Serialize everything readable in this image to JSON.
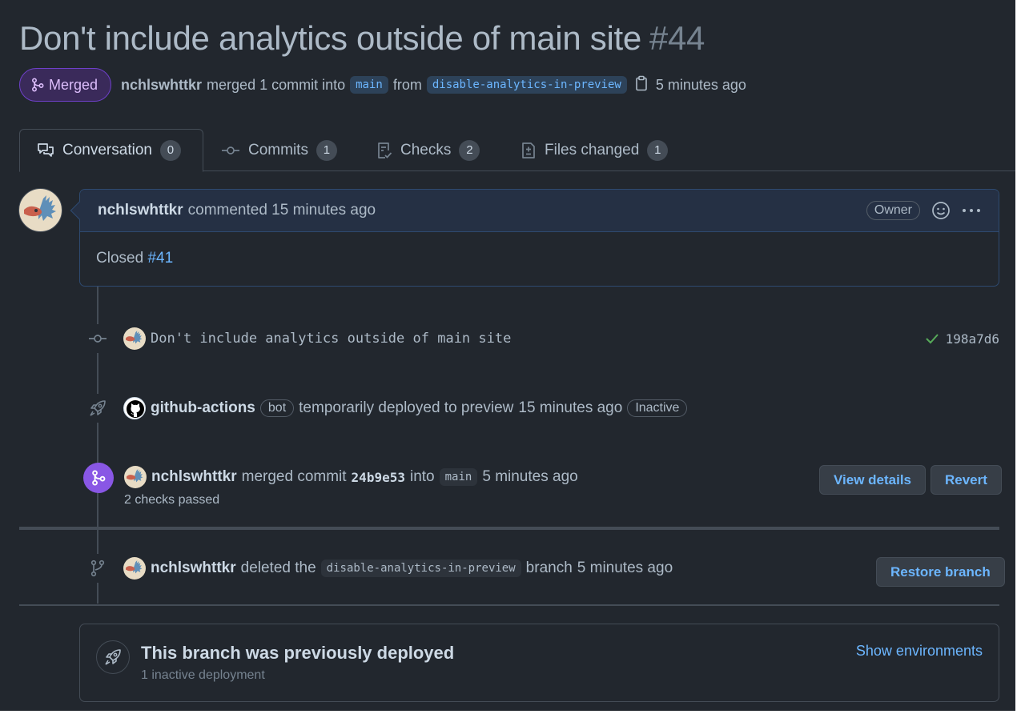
{
  "pr": {
    "title": "Don't include analytics outside of main site",
    "number": "#44",
    "state": "Merged",
    "author": "nchlswhttkr",
    "merged_text": "merged 1 commit into",
    "base_branch": "main",
    "from_text": "from",
    "head_branch": "disable-analytics-in-preview",
    "time": "5 minutes ago"
  },
  "tabs": [
    {
      "label": "Conversation",
      "count": "0"
    },
    {
      "label": "Commits",
      "count": "1"
    },
    {
      "label": "Checks",
      "count": "2"
    },
    {
      "label": "Files changed",
      "count": "1"
    }
  ],
  "comment": {
    "author": "nchlswhttkr",
    "action": "commented 15 minutes ago",
    "badge": "Owner",
    "body_text": "Closed",
    "body_link": "#41"
  },
  "commit_event": {
    "message": "Don't include analytics outside of main site",
    "sha": "198a7d6"
  },
  "deploy_event": {
    "actor": "github-actions",
    "bot_label": "bot",
    "text": "temporarily deployed to preview",
    "time": "15 minutes ago",
    "status": "Inactive"
  },
  "merge_event": {
    "actor": "nchlswhttkr",
    "text1": "merged commit",
    "commit": "24b9e53",
    "text2": "into",
    "branch": "main",
    "time": "5 minutes ago",
    "checks": "2 checks passed",
    "view_details": "View details",
    "revert": "Revert"
  },
  "delete_event": {
    "actor": "nchlswhttkr",
    "text1": "deleted the",
    "branch": "disable-analytics-in-preview",
    "text2": "branch",
    "time": "5 minutes ago",
    "restore": "Restore branch"
  },
  "deploy_box": {
    "title": "This branch was previously deployed",
    "subtitle": "1 inactive deployment",
    "link": "Show environments"
  },
  "colors": {
    "background": "#22272e",
    "accent": "#6cb6ff",
    "merged": "#8957e5",
    "success": "#57ab5a"
  }
}
